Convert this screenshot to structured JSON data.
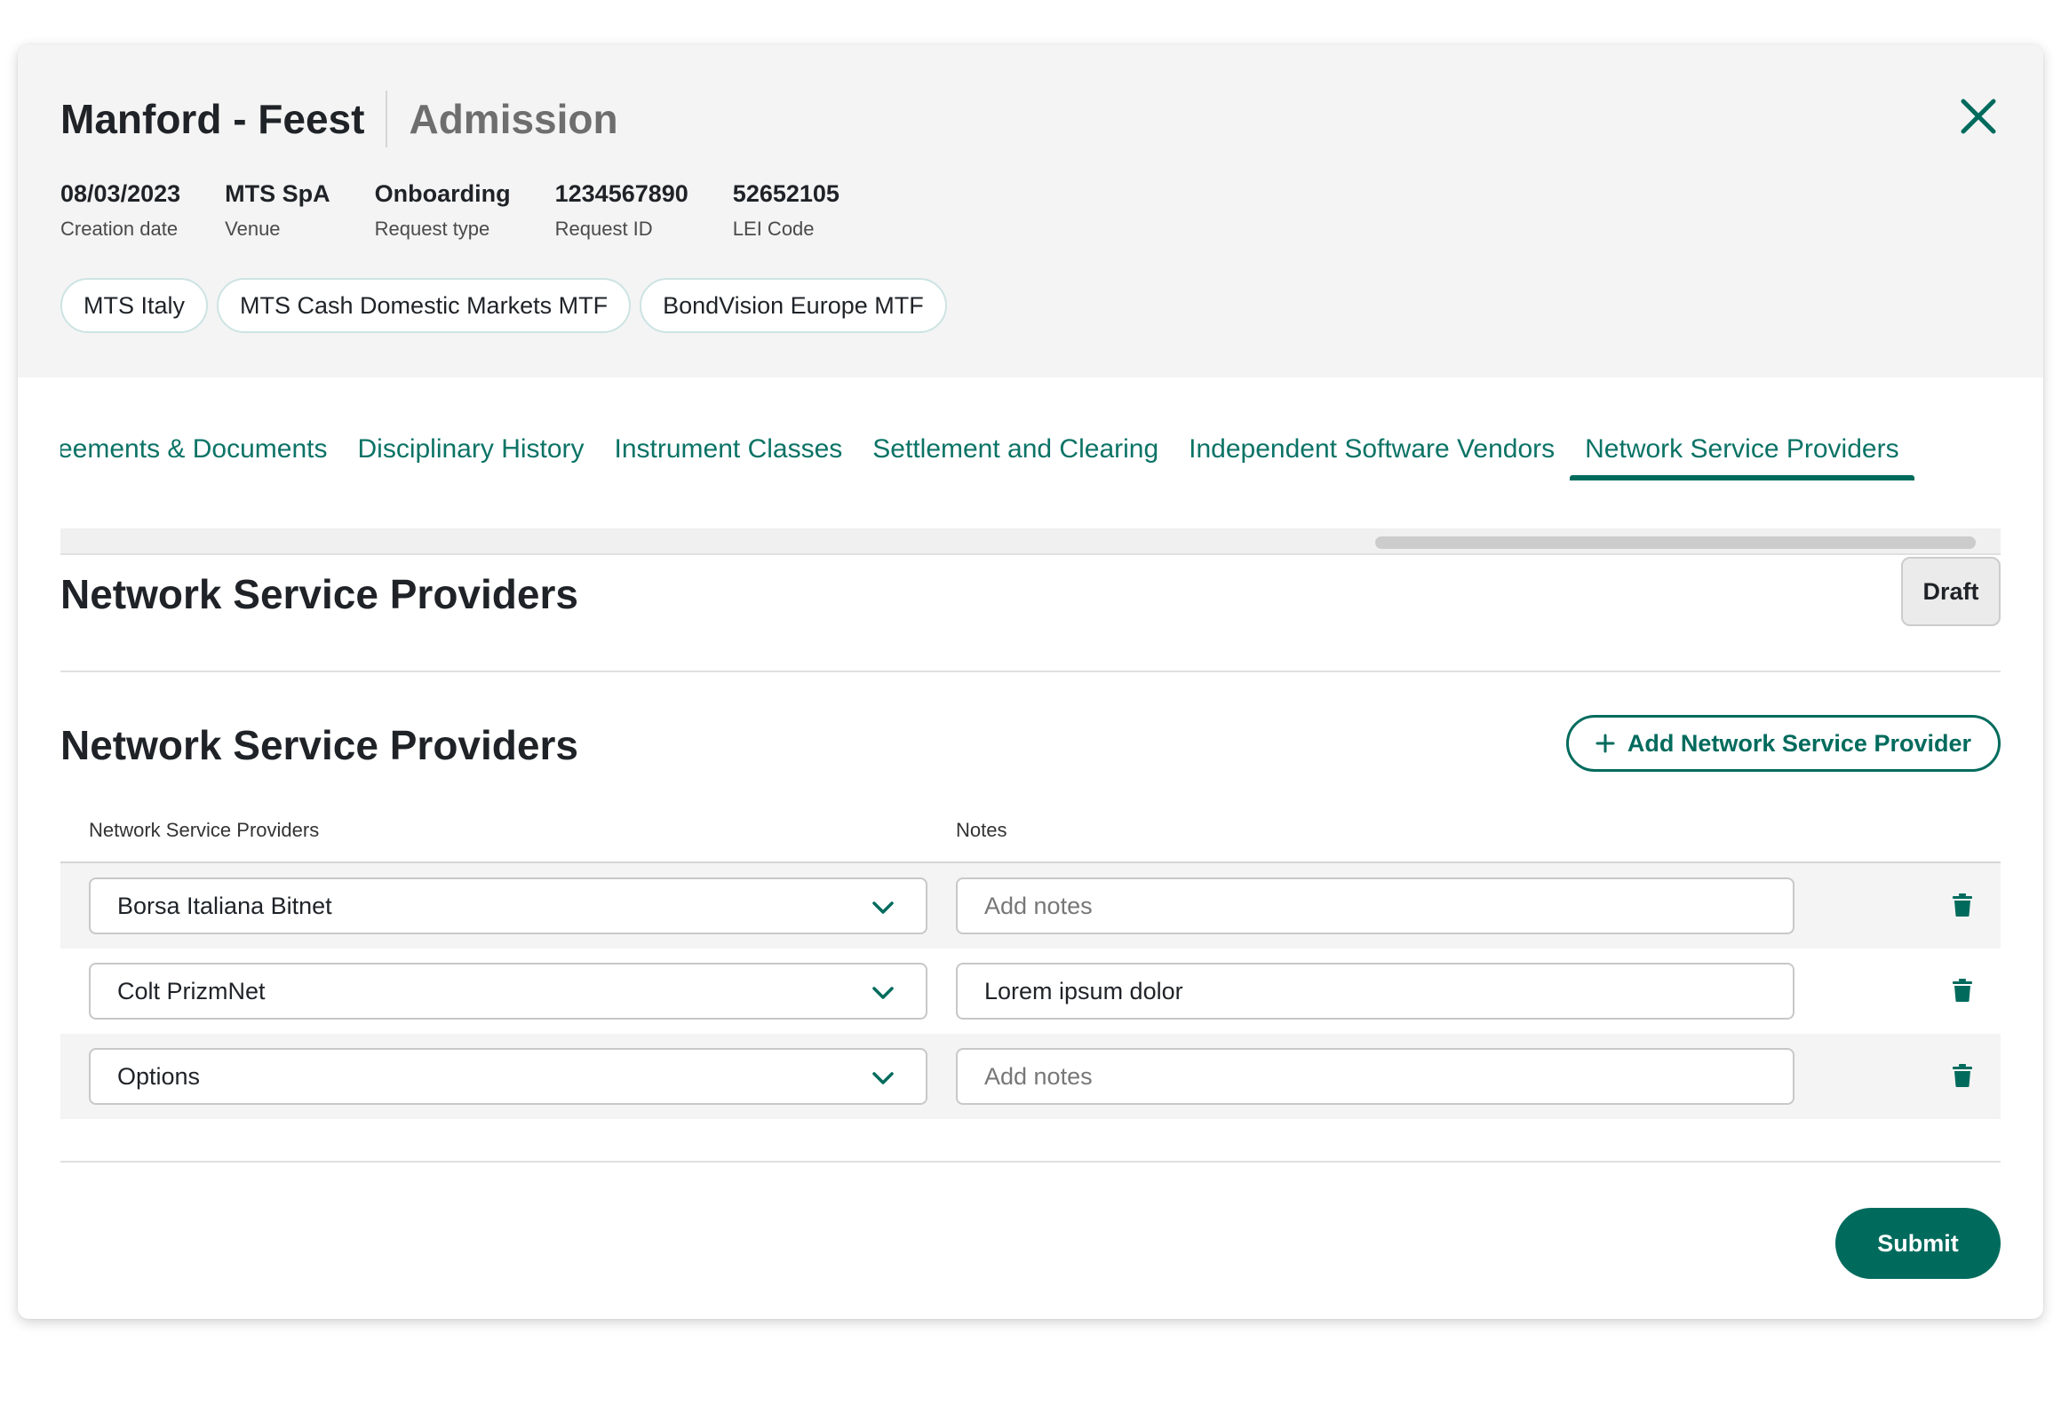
{
  "header": {
    "title": "Manford - Feest",
    "subtitle": "Admission"
  },
  "meta": [
    {
      "value": "08/03/2023",
      "label": "Creation date"
    },
    {
      "value": "MTS SpA",
      "label": "Venue"
    },
    {
      "value": "Onboarding",
      "label": "Request type"
    },
    {
      "value": "1234567890",
      "label": "Request ID"
    },
    {
      "value": "52652105",
      "label": "LEI Code"
    }
  ],
  "chips": [
    "MTS Italy",
    "MTS Cash Domestic Markets MTF",
    "BondVision Europe MTF"
  ],
  "tabs": [
    {
      "label": "eements & Documents"
    },
    {
      "label": "Disciplinary History"
    },
    {
      "label": "Instrument Classes"
    },
    {
      "label": "Settlement and Clearing"
    },
    {
      "label": "Independent Software Vendors"
    },
    {
      "label": "Network Service Providers",
      "active": true
    }
  ],
  "page": {
    "section_title": "Network Service Providers",
    "status": "Draft"
  },
  "subsection": {
    "title": "Network Service Providers",
    "add_label": "Add Network Service Provider"
  },
  "table": {
    "columns": [
      "Network Service Providers",
      "Notes"
    ],
    "rows": [
      {
        "provider": "Borsa Italiana Bitnet",
        "notes": "",
        "notes_placeholder": "Add notes"
      },
      {
        "provider": "Colt PrizmNet",
        "notes": "Lorem ipsum dolor",
        "notes_placeholder": "Add notes"
      },
      {
        "provider": "Options",
        "notes": "",
        "notes_placeholder": "Add notes"
      }
    ]
  },
  "footer": {
    "submit_label": "Submit"
  },
  "colors": {
    "accent": "#006b5d",
    "tab_text": "#0b7366",
    "header_bg": "#f4f4f4"
  },
  "icons": {
    "close": "close-icon",
    "add": "plus-icon",
    "chevron": "chevron-down-icon",
    "delete": "trash-icon"
  }
}
